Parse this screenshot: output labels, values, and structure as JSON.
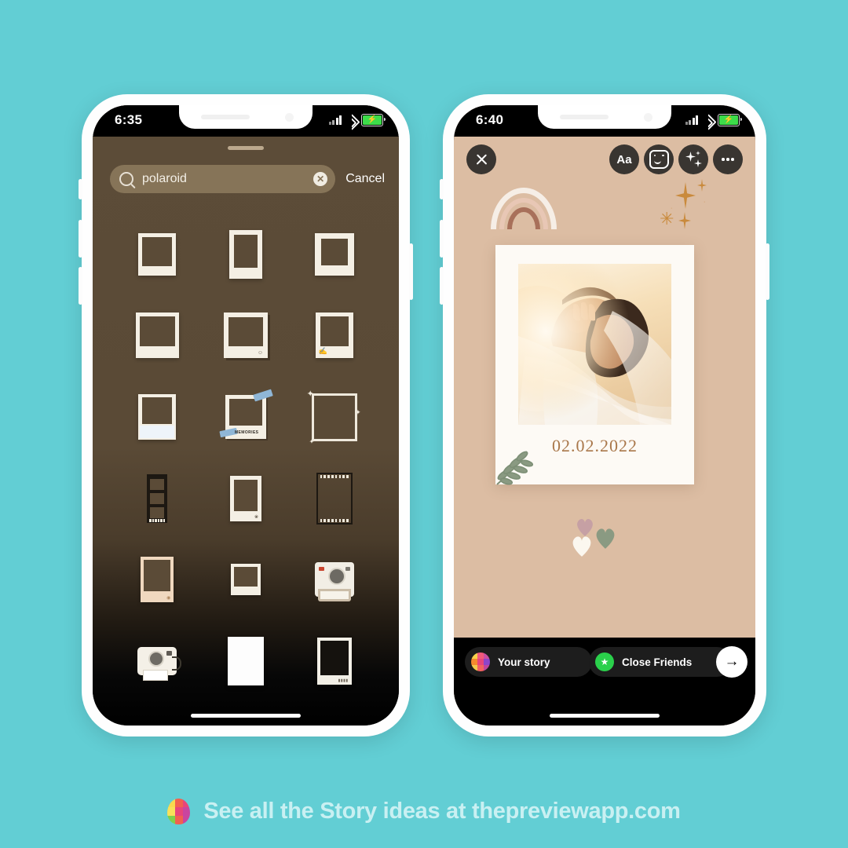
{
  "background_color": "#62ced4",
  "footer": {
    "text": "See all the Story ideas at thepreviewapp.com",
    "logo_name": "preview-app-logo",
    "text_color": "#c9f0f2"
  },
  "left_phone": {
    "name": "instagram-sticker-search",
    "status_bar": {
      "time": "6:35",
      "signal_icon": "signal-bars-icon",
      "wifi_icon": "wifi-icon",
      "battery_icon": "battery-charging-icon",
      "battery_color": "#3ddc4a"
    },
    "sheet": {
      "background_top": "#5c4c38",
      "background_bottom": "#000000",
      "grabber_name": "sheet-drag-handle"
    },
    "search": {
      "value": "polaroid",
      "placeholder": "Search",
      "icon": "search-icon",
      "clear_icon": "clear-x-icon",
      "cancel_label": "Cancel",
      "field_color": "#867458"
    },
    "sticker_grid": {
      "columns": 3,
      "rows": 6,
      "items": [
        {
          "id": 1,
          "label": "polaroid-frame-square"
        },
        {
          "id": 2,
          "label": "polaroid-frame-tall"
        },
        {
          "id": 3,
          "label": "polaroid-frame-thick"
        },
        {
          "id": 4,
          "label": "polaroid-frame-wide"
        },
        {
          "id": 5,
          "label": "polaroid-frame-shadow"
        },
        {
          "id": 6,
          "label": "polaroid-frame-hand"
        },
        {
          "id": 7,
          "label": "polaroid-frame-blue-bottom"
        },
        {
          "id": 8,
          "label": "polaroid-memories-tape"
        },
        {
          "id": 9,
          "label": "polaroid-frame-sparkle"
        },
        {
          "id": 10,
          "label": "film-strip-vertical"
        },
        {
          "id": 11,
          "label": "polaroid-frame-plain"
        },
        {
          "id": 12,
          "label": "film-negative-strip"
        },
        {
          "id": 13,
          "label": "polaroid-frame-peach"
        },
        {
          "id": 14,
          "label": "polaroid-frame-small"
        },
        {
          "id": 15,
          "label": "polaroid-camera-photo"
        },
        {
          "id": 16,
          "label": "polaroid-camera-classic"
        },
        {
          "id": 17,
          "label": "blank-white-card"
        },
        {
          "id": 18,
          "label": "polaroid-frame-dark"
        }
      ],
      "memories_label": "MEMORIES"
    }
  },
  "right_phone": {
    "name": "instagram-story-editor",
    "status_bar": {
      "time": "6:40",
      "signal_icon": "signal-bars-icon",
      "wifi_icon": "wifi-icon",
      "battery_icon": "battery-charging-icon",
      "battery_color": "#3ddc4a"
    },
    "canvas": {
      "background_color": "#dcbda3"
    },
    "toolbar": {
      "close_icon": "close-x-icon",
      "text_tool_label": "Aa",
      "sticker_icon": "sticker-smiley-icon",
      "effects_icon": "sparkles-icon",
      "more_icon": "more-options-icon"
    },
    "stickers": {
      "rainbow": {
        "name": "boho-rainbow-sticker",
        "colors": [
          "#f4ece4",
          "#e6c6b6",
          "#a8705a"
        ]
      },
      "sparkles": {
        "name": "gold-sparkles-sticker",
        "color": "#c98a3c"
      },
      "leaf": {
        "name": "olive-branch-sticker",
        "color": "#8a9a82"
      },
      "hearts": {
        "name": "hearts-sticker-trio",
        "colors": [
          "#c6a0a4",
          "#8a9a82",
          "#fbf7ef"
        ]
      }
    },
    "polaroid_card": {
      "name": "wedding-polaroid-card",
      "date": "02.02.2022",
      "date_color": "#a9774a",
      "card_color": "#fdfaf5",
      "photo_alt": "wedding-couple-sunset-photo"
    },
    "share_bar": {
      "your_story_label": "Your story",
      "your_story_icon": "instagram-grid-avatar",
      "close_friends_label": "Close Friends",
      "close_friends_icon": "close-friends-star-icon",
      "close_friends_color": "#2ad04b",
      "send_icon": "arrow-right-icon"
    }
  }
}
